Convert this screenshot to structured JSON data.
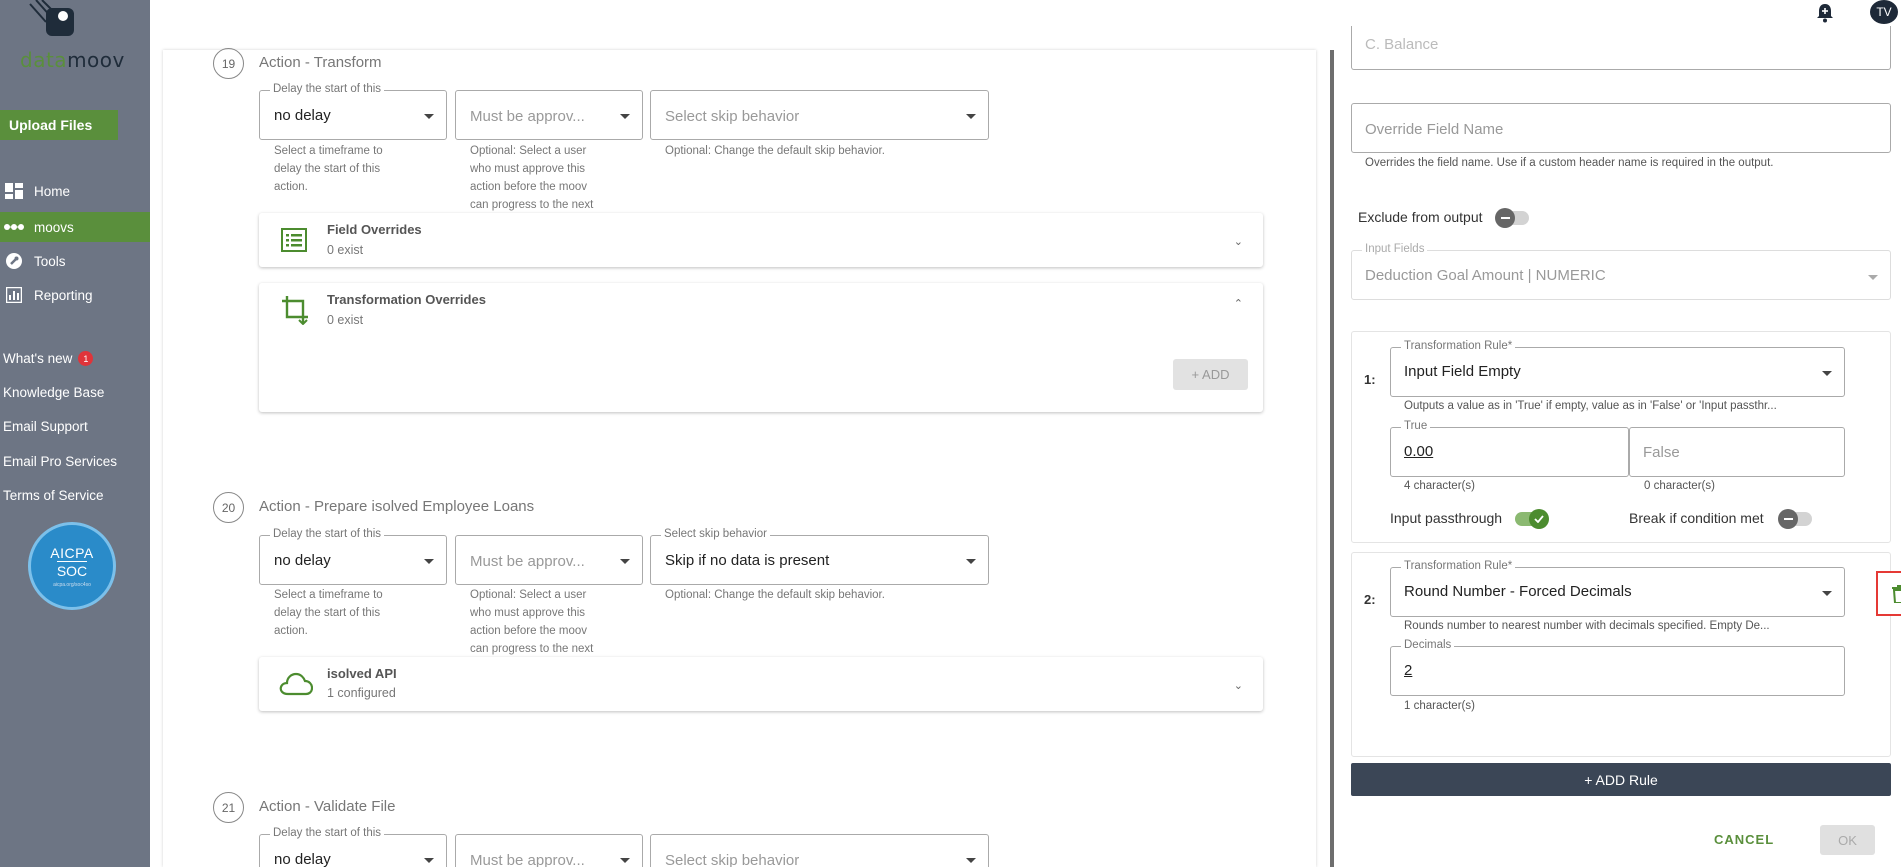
{
  "brand": {
    "logo_text_a": "data",
    "logo_text_b": "moov",
    "accent": "#5a8f3c",
    "sidebar_bg": "#6d7584"
  },
  "sidebar": {
    "upload_label": "Upload Files",
    "nav": [
      {
        "label": "Home",
        "icon": "dashboard-icon"
      },
      {
        "label": "moovs",
        "icon": "moovs-icon"
      },
      {
        "label": "Tools",
        "icon": "wrench-icon"
      },
      {
        "label": "Reporting",
        "icon": "bar-chart-icon"
      }
    ],
    "links": [
      {
        "label": "What's new",
        "badge": "1"
      },
      {
        "label": "Knowledge Base"
      },
      {
        "label": "Email Support"
      },
      {
        "label": "Email Pro Services"
      },
      {
        "label": "Terms of Service"
      }
    ],
    "aicpa": {
      "line1": "AICPA",
      "line2": "SOC",
      "line3": "aicpa.org/soc4so"
    }
  },
  "topbar": {
    "avatar": "TV",
    "bell_icon": "bell-plus-icon"
  },
  "steps": [
    {
      "num": "19",
      "title": "Action - Transform",
      "delay_label": "Delay the start of this",
      "delay_value": "no delay",
      "approve_placeholder": "Must be approv...",
      "skip_label": "",
      "skip_value": "",
      "skip_placeholder": "Select skip behavior",
      "help_delay": [
        "Select a timeframe to",
        "delay the start of this",
        "action."
      ],
      "help_approve": [
        "Optional: Select a user",
        "who must approve this",
        "action before the moov",
        "can progress to the next"
      ],
      "help_skip": "Optional: Change the default skip behavior."
    },
    {
      "num": "20",
      "title": "Action - Prepare isolved Employee Loans",
      "delay_label": "Delay the start of this",
      "delay_value": "no delay",
      "approve_placeholder": "Must be approv...",
      "skip_label": "Select skip behavior",
      "skip_value": "Skip if no data is present",
      "skip_placeholder": "",
      "help_delay": [
        "Select a timeframe to",
        "delay the start of this",
        "action."
      ],
      "help_approve": [
        "Optional: Select a user",
        "who must approve this",
        "action before the moov",
        "can progress to the next"
      ],
      "help_skip": "Optional: Change the default skip behavior."
    },
    {
      "num": "21",
      "title": "Action - Validate File",
      "delay_label": "Delay the start of this",
      "delay_value": "no delay",
      "approve_placeholder": "Must be approv...",
      "skip_placeholder": "Select skip behavior"
    }
  ],
  "cards": {
    "field_overrides": {
      "title": "Field Overrides",
      "sub": "0 exist",
      "icon": "list-icon"
    },
    "transformation_overrides": {
      "title": "Transformation Overrides",
      "sub": "0 exist",
      "icon": "crop-icon",
      "add_label": "+ ADD"
    },
    "isolved_api": {
      "title": "isolved API",
      "sub": "1 configured",
      "icon": "cloud-icon"
    }
  },
  "panel": {
    "top_field_value": "C. Balance",
    "override_placeholder": "Override Field Name",
    "override_help": "Overrides the field name. Use if a custom header name is required in the output.",
    "exclude_label": "Exclude from output",
    "input_fields_label": "Input Fields",
    "input_fields_value": "Deduction Goal Amount | NUMERIC",
    "rules": [
      {
        "num": "1:",
        "label": "Transformation Rule*",
        "value": "Input Field Empty",
        "help": "Outputs a value as in 'True' if empty, value as in 'False' or 'Input passthr...",
        "true_label": "True",
        "true_value": "0.00",
        "true_count": "4 character(s)",
        "false_placeholder": "False",
        "false_count": "0 character(s)",
        "passthrough_label": "Input passthrough",
        "break_label": "Break if condition met"
      },
      {
        "num": "2:",
        "label": "Transformation Rule*",
        "value": "Round Number - Forced Decimals",
        "help": "Rounds number to nearest number with decimals specified. Empty De...",
        "decimals_label": "Decimals",
        "decimals_value": "2",
        "decimals_count": "1 character(s)"
      }
    ],
    "add_rule": "+ ADD Rule",
    "cancel": "CANCEL",
    "ok": "OK"
  }
}
